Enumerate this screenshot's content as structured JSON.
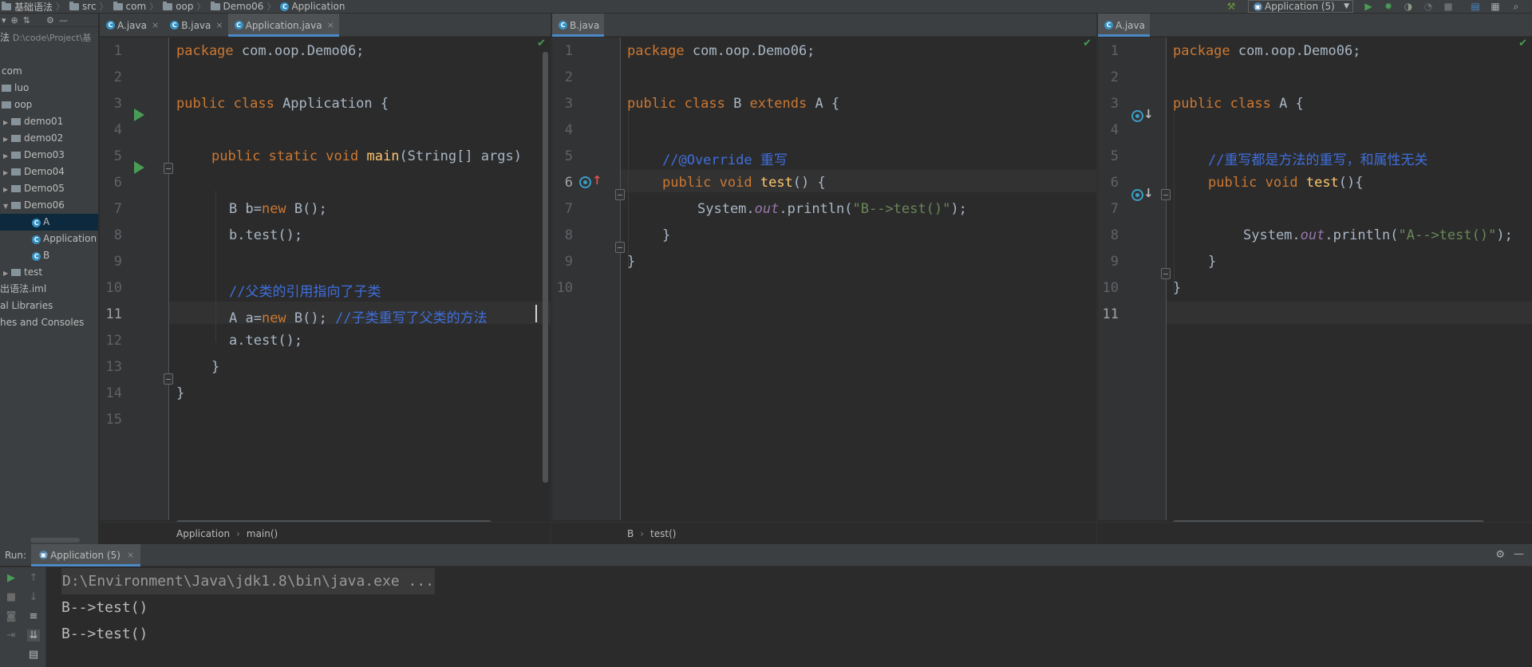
{
  "navbar": {
    "crumbs": [
      "基础语法",
      "src",
      "com",
      "oop",
      "Demo06",
      "Application"
    ]
  },
  "toolbar": {
    "run_config": "Application (5)"
  },
  "project_tree": {
    "root_label": "法",
    "root_path": "D:\\code\\Project\\基",
    "items": [
      {
        "label": "com"
      },
      {
        "label": "luo"
      },
      {
        "label": "oop"
      },
      {
        "label": "demo01"
      },
      {
        "label": "demo02"
      },
      {
        "label": "Demo03"
      },
      {
        "label": "Demo04"
      },
      {
        "label": "Demo05"
      },
      {
        "label": "Demo06"
      },
      {
        "label": "A"
      },
      {
        "label": "Application"
      },
      {
        "label": "B"
      },
      {
        "label": "test"
      },
      {
        "label": "出语法.iml"
      },
      {
        "label": "al Libraries"
      },
      {
        "label": "hes and Consoles"
      }
    ]
  },
  "editor_left": {
    "tabs": [
      {
        "label": "A.java"
      },
      {
        "label": "B.java"
      },
      {
        "label": "Application.java"
      }
    ],
    "line_numbers": [
      "1",
      "2",
      "3",
      "4",
      "5",
      "6",
      "7",
      "8",
      "9",
      "10",
      "11",
      "12",
      "13",
      "14",
      "15"
    ],
    "code": {
      "l1_kw": "package",
      "l1_rest": " com.oop.Demo06;",
      "l3_kw": "public class",
      "l3_rest": " Application {",
      "l5_kw": "public static void",
      "l5_fn": "main",
      "l5_rest": "(String[] args)",
      "l7_a": "B b=",
      "l7_kw": "new",
      "l7_b": " B();",
      "l8": "b.test();",
      "l10_cm": "//父类的引用指向了子类",
      "l11_a": "A a=",
      "l11_kw": "new",
      "l11_b": " B(); ",
      "l11_cm": "//子类重写了父类的方法",
      "l12": "a.test();",
      "l13": "}",
      "l14": "}"
    },
    "breadcrumb": [
      "Application",
      "main()"
    ]
  },
  "editor_mid": {
    "tabs": [
      {
        "label": "B.java"
      }
    ],
    "line_numbers": [
      "1",
      "2",
      "3",
      "4",
      "5",
      "6",
      "7",
      "8",
      "9",
      "10"
    ],
    "code": {
      "l1_kw": "package",
      "l1_rest": " com.oop.Demo06;",
      "l3_kw": "public class",
      "l3_mid": " B ",
      "l3_kw2": "extends",
      "l3_rest": " A {",
      "l5_cm": "//@Override 重写",
      "l6_kw": "public void",
      "l6_fn": "test",
      "l6_rest": "() {",
      "l7_a": "System.",
      "l7_it": "out",
      "l7_b": ".println(",
      "l7_st": "\"B-->test()\"",
      "l7_c": ");",
      "l8": "}",
      "l9": "}"
    },
    "breadcrumb": [
      "B",
      "test()"
    ]
  },
  "editor_right": {
    "tabs": [
      {
        "label": "A.java"
      }
    ],
    "line_numbers": [
      "1",
      "2",
      "3",
      "4",
      "5",
      "6",
      "7",
      "8",
      "9",
      "10",
      "11"
    ],
    "code": {
      "l1_kw": "package",
      "l1_rest": " com.oop.Demo06;",
      "l3_kw": "public class",
      "l3_rest": " A {",
      "l5_cm": "//重写都是方法的重写，和属性无关",
      "l6_kw": "public void",
      "l6_fn": "test",
      "l6_rest": "(){",
      "l8_a": "System.",
      "l8_it": "out",
      "l8_b": ".println(",
      "l8_st": "\"A-->test()\"",
      "l8_c": ");",
      "l9": "}",
      "l10": "}"
    }
  },
  "run_window": {
    "label": "Run:",
    "tab": "Application (5)",
    "console": [
      "D:\\Environment\\Java\\jdk1.8\\bin\\java.exe ...",
      "B-->test()",
      "B-->test()"
    ]
  },
  "colors": {
    "keyword": "#cc7832",
    "comment": "#3f6fdc",
    "string": "#6a8759",
    "function": "#ffc66d",
    "field": "#9876aa",
    "accent": "#4a88c7",
    "run_green": "#499c54"
  }
}
